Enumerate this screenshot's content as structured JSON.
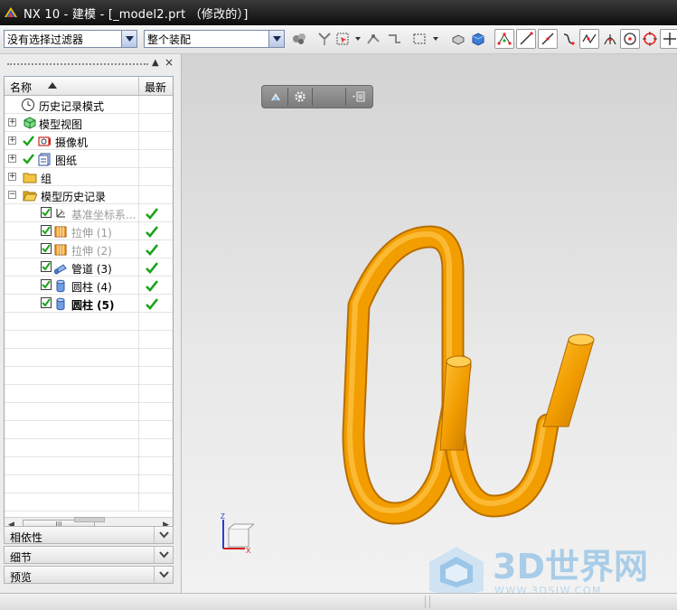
{
  "titlebar": {
    "title": "NX 10 - 建模 - [_model2.prt （修改的）]"
  },
  "toolbar": {
    "selection_filter": "没有选择过滤器",
    "scope": "整个装配"
  },
  "part_navigator": {
    "columns": {
      "name": "名称",
      "latest": "最新"
    },
    "items": [
      {
        "label": "历史记录模式",
        "icon": "clock-icon"
      },
      {
        "label": "模型视图",
        "icon": "model-views-icon"
      },
      {
        "label": "摄像机",
        "icon": "camera-icon"
      },
      {
        "label": "图纸",
        "icon": "drawing-icon"
      },
      {
        "label": "组",
        "icon": "folder-icon"
      },
      {
        "label": "模型历史记录",
        "icon": "folder-open-icon"
      },
      {
        "label": "基准坐标系...",
        "icon": "datum-csys-icon"
      },
      {
        "label": "拉伸 (1)",
        "icon": "extrude-icon"
      },
      {
        "label": "拉伸 (2)",
        "icon": "extrude-icon"
      },
      {
        "label": "管道 (3)",
        "icon": "tube-icon"
      },
      {
        "label": "圆柱 (4)",
        "icon": "cylinder-icon"
      },
      {
        "label": "圆柱 (5)",
        "icon": "cylinder-icon"
      }
    ],
    "scroll_thumb_label": "III"
  },
  "panels": {
    "dependencies": "相依性",
    "details": "细节",
    "preview": "预览"
  },
  "viewport": {
    "triad_z": "Z",
    "triad_x": "X",
    "watermark_text": "3D世界网",
    "watermark_url": "WWW.3DSJW.COM"
  },
  "colors": {
    "model": "#f29d00",
    "check_green": "#1aa31a",
    "watermark": "#a9cde8"
  }
}
